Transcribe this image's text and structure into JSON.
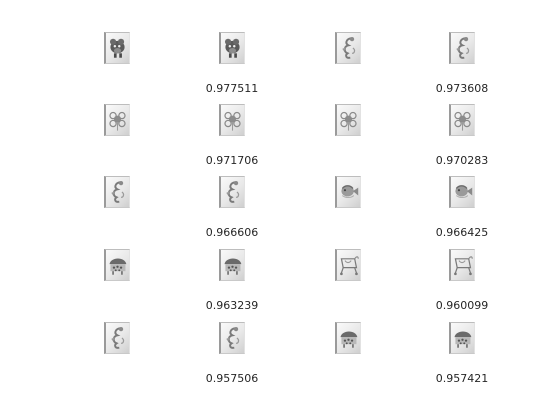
{
  "pairs": [
    {
      "query_icon": "puppy-icon",
      "match_icon": "puppy-icon",
      "score": "0.977511"
    },
    {
      "query_icon": "dragon-icon",
      "match_icon": "dragon-icon",
      "score": "0.973608"
    },
    {
      "query_icon": "flower-icon",
      "match_icon": "flower-icon",
      "score": "0.971706"
    },
    {
      "query_icon": "flower-icon",
      "match_icon": "flower-icon",
      "score": "0.970283"
    },
    {
      "query_icon": "dragon-icon",
      "match_icon": "dragon-icon",
      "score": "0.966606"
    },
    {
      "query_icon": "fish-icon",
      "match_icon": "fish-icon",
      "score": "0.966425"
    },
    {
      "query_icon": "ladybug-icon",
      "match_icon": "ladybug-icon",
      "score": "0.963239"
    },
    {
      "query_icon": "cart-icon",
      "match_icon": "cart-icon",
      "score": "0.960099"
    },
    {
      "query_icon": "dragon-icon",
      "match_icon": "dragon-icon",
      "score": "0.957506"
    },
    {
      "query_icon": "ladybug-icon",
      "match_icon": "ladybug-icon",
      "score": "0.957421"
    }
  ]
}
